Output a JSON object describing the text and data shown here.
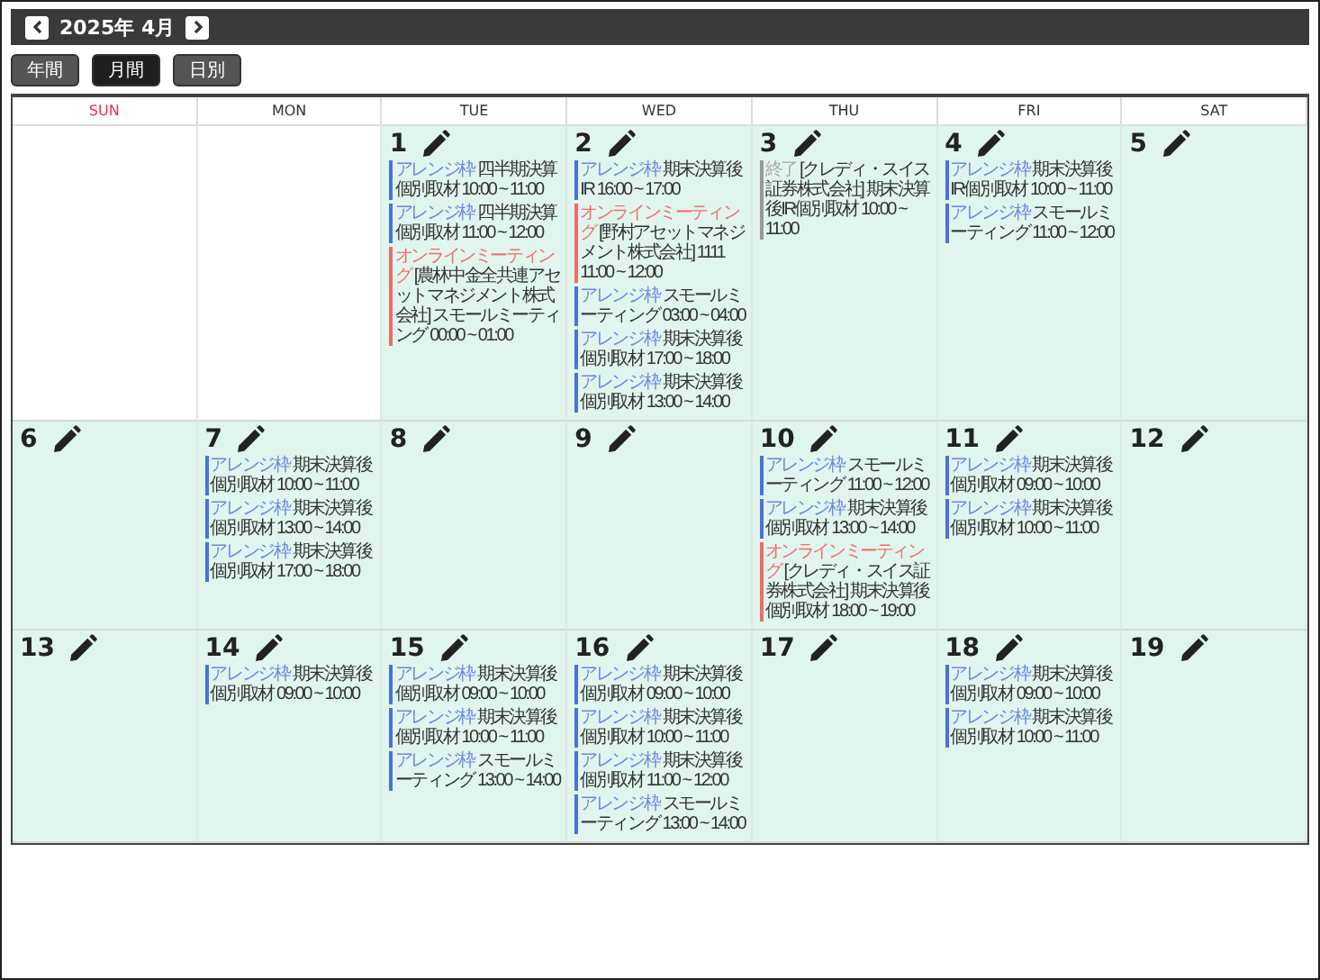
{
  "header": {
    "title": "2025年 4月"
  },
  "views": [
    {
      "label": "年間",
      "selected": false
    },
    {
      "label": "月間",
      "selected": true
    },
    {
      "label": "日別",
      "selected": false
    }
  ],
  "weekdays": [
    {
      "label": "SUN",
      "color": "#e8334a"
    },
    {
      "label": "MON",
      "color": "#333333"
    },
    {
      "label": "TUE",
      "color": "#333333"
    },
    {
      "label": "WED",
      "color": "#333333"
    },
    {
      "label": "THU",
      "color": "#333333"
    },
    {
      "label": "FRI",
      "color": "#333333"
    },
    {
      "label": "SAT",
      "color": "#333333"
    }
  ],
  "weeks": [
    [
      {
        "in_month": false
      },
      {
        "in_month": false
      },
      {
        "in_month": true,
        "date": "1",
        "events": [
          {
            "kind": "arrange",
            "tag": "アレンジ枠",
            "text": "四半期決算個別取材 10:00 ~ 11:00"
          },
          {
            "kind": "arrange",
            "tag": "アレンジ枠",
            "text": "四半期決算個別取材 11:00 ~ 12:00"
          },
          {
            "kind": "online",
            "tag": "オンラインミーティング",
            "text": "[農林中金全共連アセットマネジメント株式会社] スモールミーティング 00:00 ~ 01:00"
          }
        ]
      },
      {
        "in_month": true,
        "date": "2",
        "events": [
          {
            "kind": "arrange",
            "tag": "アレンジ枠",
            "text": "期末決算後IR 16:00 ~ 17:00"
          },
          {
            "kind": "online",
            "tag": "オンラインミーティング",
            "text": "[野村アセットマネジメント株式会社] 1111 11:00 ~ 12:00"
          },
          {
            "kind": "arrange",
            "tag": "アレンジ枠",
            "text": "スモールミーティング 03:00 ~ 04:00"
          },
          {
            "kind": "arrange",
            "tag": "アレンジ枠",
            "text": "期末決算後個別取材 17:00 ~ 18:00"
          },
          {
            "kind": "arrange",
            "tag": "アレンジ枠",
            "text": "期末決算後個別取材 13:00 ~ 14:00"
          }
        ]
      },
      {
        "in_month": true,
        "date": "3",
        "events": [
          {
            "kind": "done",
            "tag": "終了",
            "text": "[クレディ・スイス証券株式会社] 期末決算後IR個別取材 10:00 ~ 11:00"
          }
        ]
      },
      {
        "in_month": true,
        "date": "4",
        "events": [
          {
            "kind": "arrange",
            "tag": "アレンジ枠",
            "text": "期末決算後IR個別取材 10:00 ~ 11:00"
          },
          {
            "kind": "arrange",
            "tag": "アレンジ枠",
            "text": "スモールミーティング 11:00 ~ 12:00"
          }
        ]
      },
      {
        "in_month": true,
        "date": "5"
      }
    ],
    [
      {
        "in_month": true,
        "date": "6"
      },
      {
        "in_month": true,
        "date": "7",
        "events": [
          {
            "kind": "arrange",
            "tag": "アレンジ枠",
            "text": "期末決算後個別取材 10:00 ~ 11:00"
          },
          {
            "kind": "arrange",
            "tag": "アレンジ枠",
            "text": "期末決算後個別取材 13:00 ~ 14:00"
          },
          {
            "kind": "arrange",
            "tag": "アレンジ枠",
            "text": "期末決算後個別取材 17:00 ~ 18:00"
          }
        ]
      },
      {
        "in_month": true,
        "date": "8"
      },
      {
        "in_month": true,
        "date": "9"
      },
      {
        "in_month": true,
        "date": "10",
        "events": [
          {
            "kind": "arrange",
            "tag": "アレンジ枠",
            "text": "スモールミーティング 11:00 ~ 12:00"
          },
          {
            "kind": "arrange",
            "tag": "アレンジ枠",
            "text": "期末決算後個別取材 13:00 ~ 14:00"
          },
          {
            "kind": "online",
            "tag": "オンラインミーティング",
            "text": "[クレディ・スイス証券株式会社] 期末決算後個別取材 18:00 ~ 19:00"
          }
        ]
      },
      {
        "in_month": true,
        "date": "11",
        "events": [
          {
            "kind": "arrange",
            "tag": "アレンジ枠",
            "text": "期末決算後個別取材 09:00 ~ 10:00"
          },
          {
            "kind": "arrange",
            "tag": "アレンジ枠",
            "text": "期末決算後個別取材 10:00 ~ 11:00"
          }
        ]
      },
      {
        "in_month": true,
        "date": "12"
      }
    ],
    [
      {
        "in_month": true,
        "date": "13"
      },
      {
        "in_month": true,
        "date": "14",
        "events": [
          {
            "kind": "arrange",
            "tag": "アレンジ枠",
            "text": "期末決算後個別取材 09:00 ~ 10:00"
          }
        ]
      },
      {
        "in_month": true,
        "date": "15",
        "events": [
          {
            "kind": "arrange",
            "tag": "アレンジ枠",
            "text": "期末決算後個別取材 09:00 ~ 10:00"
          },
          {
            "kind": "arrange",
            "tag": "アレンジ枠",
            "text": "期末決算後個別取材 10:00 ~ 11:00"
          },
          {
            "kind": "arrange",
            "tag": "アレンジ枠",
            "text": "スモールミーティング 13:00 ~ 14:00"
          }
        ]
      },
      {
        "in_month": true,
        "date": "16",
        "events": [
          {
            "kind": "arrange",
            "tag": "アレンジ枠",
            "text": "期末決算後個別取材 09:00 ~ 10:00"
          },
          {
            "kind": "arrange",
            "tag": "アレンジ枠",
            "text": "期末決算後個別取材 10:00 ~ 11:00"
          },
          {
            "kind": "arrange",
            "tag": "アレンジ枠",
            "text": "期末決算後個別取材 11:00 ~ 12:00"
          },
          {
            "kind": "arrange",
            "tag": "アレンジ枠",
            "text": "スモールミーティング 13:00 ~ 14:00"
          }
        ]
      },
      {
        "in_month": true,
        "date": "17"
      },
      {
        "in_month": true,
        "date": "18",
        "events": [
          {
            "kind": "arrange",
            "tag": "アレンジ枠",
            "text": "期末決算後個別取材 09:00 ~ 10:00"
          },
          {
            "kind": "arrange",
            "tag": "アレンジ枠",
            "text": "期末決算後個別取材 10:00 ~ 11:00"
          }
        ]
      },
      {
        "in_month": true,
        "date": "19"
      }
    ]
  ]
}
